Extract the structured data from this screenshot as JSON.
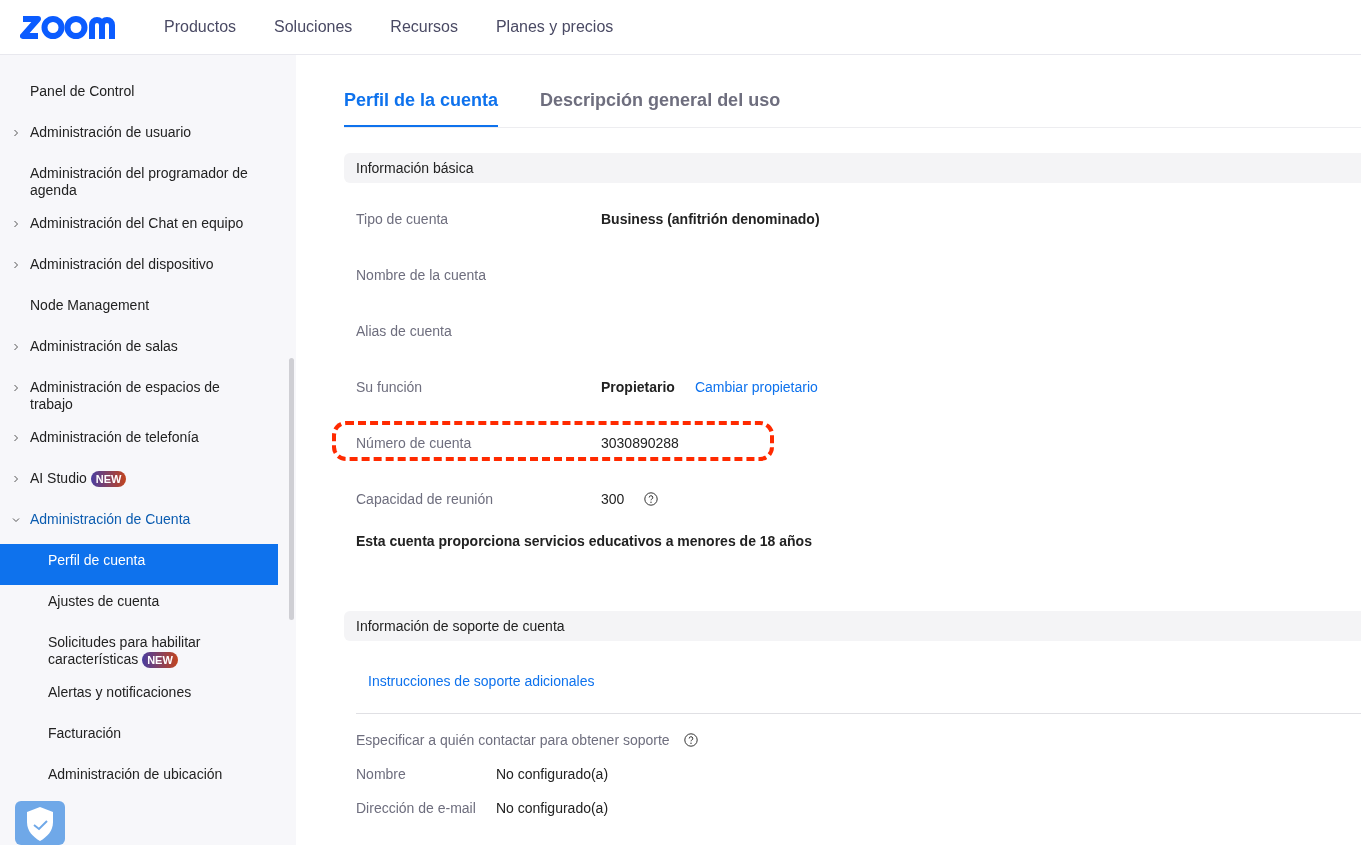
{
  "header": {
    "nav": [
      "Productos",
      "Soluciones",
      "Recursos",
      "Planes y precios"
    ]
  },
  "sidebar": {
    "items": [
      {
        "label": "Panel de Control",
        "expandable": false,
        "expanded": false,
        "selected": false
      },
      {
        "label": "Administración de usuario",
        "expandable": true,
        "expanded": false,
        "selected": false
      },
      {
        "label": "Administración del programador de agenda",
        "expandable": false,
        "expanded": false,
        "selected": false
      },
      {
        "label": "Administración del Chat en equipo",
        "expandable": true,
        "expanded": false,
        "selected": false
      },
      {
        "label": "Administración del dispositivo",
        "expandable": true,
        "expanded": false,
        "selected": false
      },
      {
        "label": "Node Management",
        "expandable": false,
        "expanded": false,
        "selected": false
      },
      {
        "label": "Administración de salas",
        "expandable": true,
        "expanded": false,
        "selected": false
      },
      {
        "label": "Administración de espacios de trabajo",
        "expandable": true,
        "expanded": false,
        "selected": false
      },
      {
        "label": "Administración de telefonía",
        "expandable": true,
        "expanded": false,
        "selected": false
      },
      {
        "label": "AI Studio",
        "badge": "NEW",
        "expandable": true,
        "expanded": false,
        "selected": false
      },
      {
        "label": "Administración de Cuenta",
        "expandable": true,
        "expanded": true,
        "selected": false,
        "children": [
          {
            "label": "Perfil de cuenta",
            "selected": true
          },
          {
            "label": "Ajustes de cuenta",
            "selected": false
          },
          {
            "label": "Solicitudes para habilitar características",
            "badge": "NEW",
            "selected": false
          },
          {
            "label": "Alertas y notificaciones",
            "selected": false
          },
          {
            "label": "Facturación",
            "selected": false
          },
          {
            "label": "Administración de ubicación",
            "selected": false
          }
        ]
      }
    ]
  },
  "tabs": [
    {
      "label": "Perfil de la cuenta",
      "selected": true
    },
    {
      "label": "Descripción general del uso",
      "selected": false
    }
  ],
  "basic_info": {
    "title": "Información básica",
    "rows": [
      {
        "label": "Tipo de cuenta",
        "value": "Business (anfitrión denominado)",
        "bold": true,
        "highlighted": false
      },
      {
        "label": "Nombre de la cuenta",
        "highlighted": false
      },
      {
        "label": "Alias de cuenta",
        "highlighted": false
      },
      {
        "label": "Su función",
        "value": "Propietario",
        "bold": true,
        "link": "Cambiar propietario",
        "highlighted": false
      },
      {
        "label": "Número de cuenta",
        "value": "3030890288",
        "highlighted": true
      },
      {
        "label": "Capacidad de reunión",
        "value": "300",
        "help": true,
        "highlighted": false
      }
    ],
    "note": "Esta cuenta proporciona servicios educativos a menores de 18 años"
  },
  "support": {
    "title": "Información de soporte de cuenta",
    "link": "Instrucciones de soporte adicionales",
    "contact_label": "Especificar a quién contactar para obtener soporte",
    "rows": [
      {
        "label": "Nombre",
        "value": "No configurado(a)"
      },
      {
        "label": "Dirección de e-mail",
        "value": "No configurado(a)"
      }
    ]
  }
}
